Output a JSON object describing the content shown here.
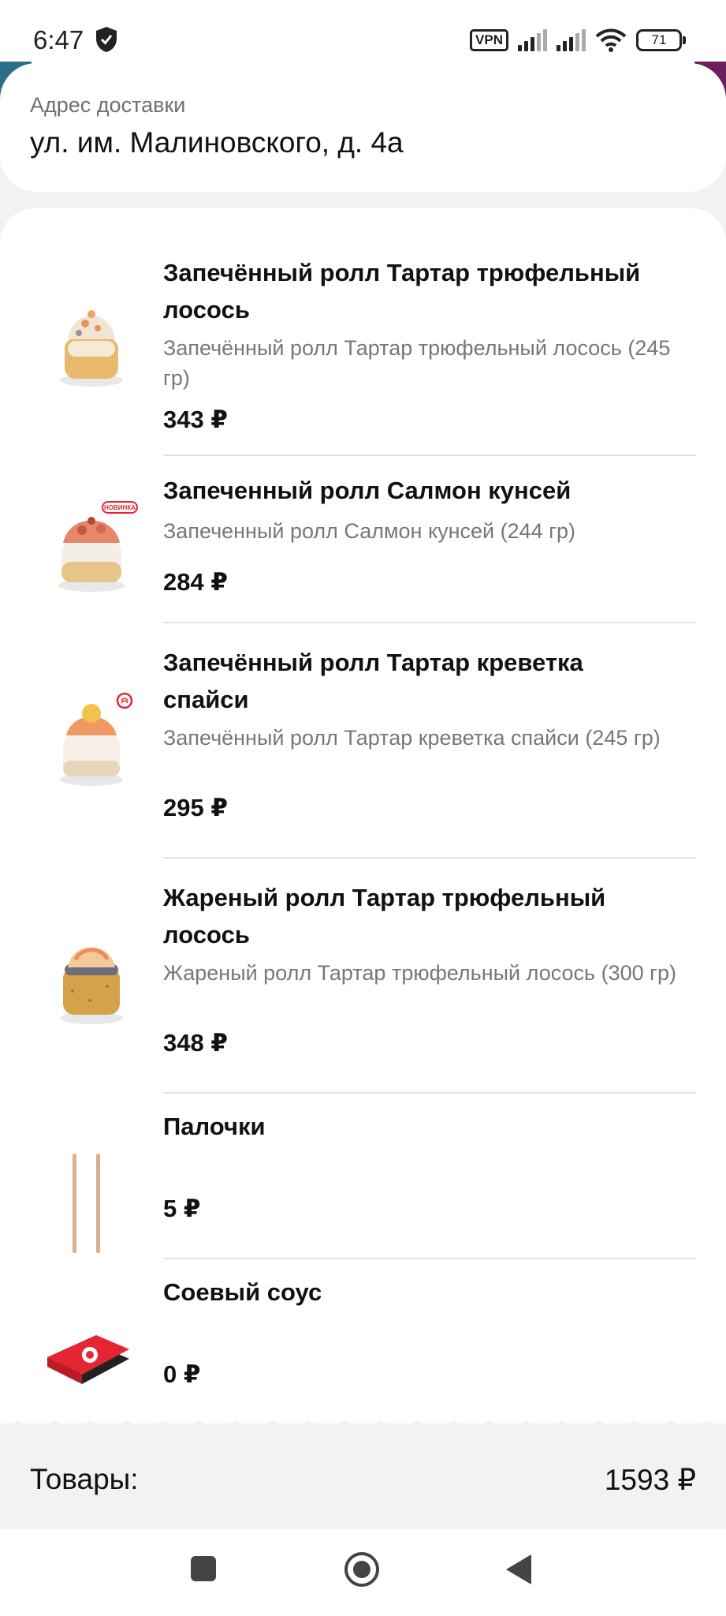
{
  "status_bar": {
    "time": "6:47",
    "vpn": "VPN",
    "battery": "71",
    "icons": [
      "shield-icon",
      "signal-icon",
      "signal-icon",
      "wifi-icon",
      "battery-icon"
    ]
  },
  "address": {
    "label": "Адрес доставки",
    "value": "ул. им. Малиновского, д. 4а"
  },
  "items": [
    {
      "title": "Запечённый ролл Тартар трюфельный лосось",
      "description": "Запечённый ролл Тартар трюфельный лосось (245 гр)",
      "price": "343 ₽"
    },
    {
      "title": "Запеченный ролл Салмон кунсей",
      "description": "Запеченный ролл Салмон кунсей (244 гр)",
      "price": "284 ₽",
      "badge": "НОВИНКА"
    },
    {
      "title": "Запечённый ролл Тартар креветка спайси",
      "description": "Запечённый ролл Тартар креветка спайси (245 гр)",
      "price": "295 ₽"
    },
    {
      "title": "Жареный ролл Тартар трюфельный лосось",
      "description": "Жареный ролл Тартар трюфельный лосось (300 гр)",
      "price": "348 ₽"
    },
    {
      "title": "Палочки",
      "description": "",
      "price": "5 ₽"
    },
    {
      "title": "Соевый соус",
      "description": "",
      "price": "0 ₽"
    }
  ],
  "totals": {
    "label": "Товары:",
    "value": "1593 ₽"
  },
  "nav": [
    "recents-icon",
    "home-icon",
    "back-icon"
  ],
  "colors": {
    "accent_red": "#e32631",
    "text_primary": "#111111",
    "text_secondary": "#777777",
    "background": "#f2f2f2"
  }
}
